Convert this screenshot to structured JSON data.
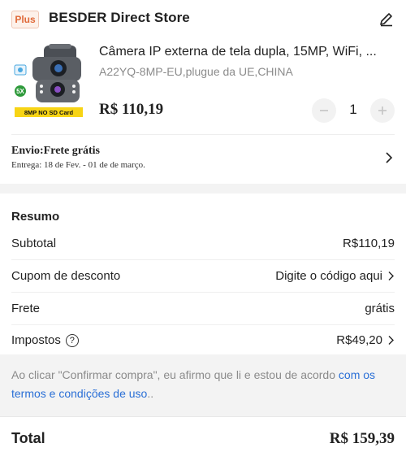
{
  "store": {
    "badge": "Plus",
    "name": "BESDER Direct Store",
    "edit_icon": "pencil-icon"
  },
  "product": {
    "title": "Câmera IP externa de tela dupla, 15MP, WiFi, ...",
    "variant": "A22YQ-8MP-EU,plugue da UE,CHINA",
    "price": "R$ 110,19",
    "quantity": "1",
    "thumb_badge": "8MP NO SD Card",
    "thumb_zoom": "5X"
  },
  "shipping": {
    "title": "Envio:Frete grátis",
    "date": "Entrega: 18 de Fev. - 01 de de março."
  },
  "summary": {
    "title": "Resumo",
    "subtotal_label": "Subtotal",
    "subtotal_value": "R$110,19",
    "coupon_label": "Cupom de desconto",
    "coupon_value": "Digite o código aqui",
    "shipping_label": "Frete",
    "shipping_value": "grátis",
    "tax_label": "Impostos",
    "tax_value": "R$49,20"
  },
  "legal": {
    "text": "Ao clicar \"Confirmar compra\", eu afirmo que li e estou de acordo ",
    "link": "com os termos e condições de uso",
    "suffix": ".."
  },
  "total": {
    "label": "Total",
    "value": "R$ 159,39"
  }
}
